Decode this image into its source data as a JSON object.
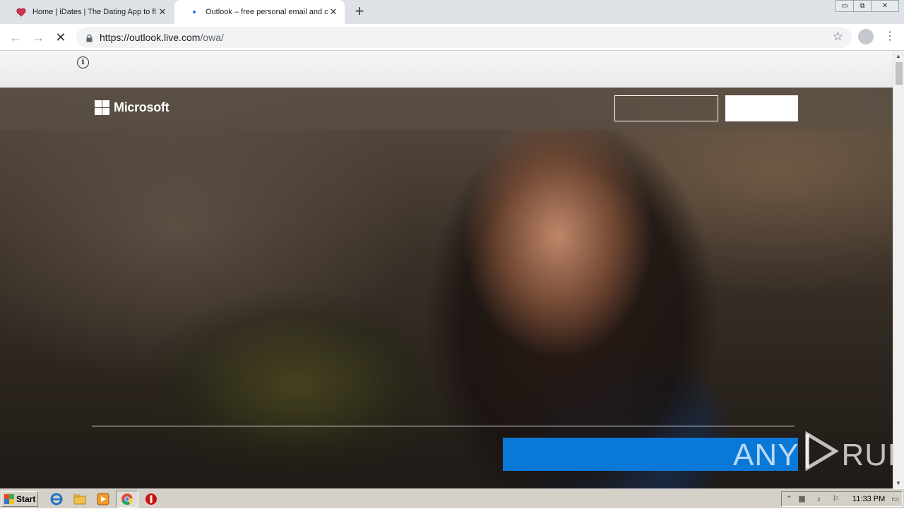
{
  "browser": {
    "tabs": [
      {
        "title": "Home | iDates | The Dating App to fl",
        "favicon": "heart-icon",
        "active": false
      },
      {
        "title": "Outlook – free personal email and ca",
        "favicon": "loading-dot-icon",
        "active": true
      }
    ],
    "new_tab_symbol": "+",
    "close_symbol": "✕",
    "url_host": "https://outlook.live.com",
    "url_path": "/owa/",
    "back_symbol": "←",
    "forward_symbol": "→",
    "reload_symbol": "✕",
    "star_symbol": "☆",
    "menu_symbol": "⋮",
    "window_controls": {
      "minimize": "▭",
      "restore": "⧉",
      "close": "✕"
    }
  },
  "page": {
    "info_symbol": "i",
    "brand": "Microsoft",
    "header_buttons": {
      "outline_label": "",
      "solid_label": ""
    },
    "cta_label": "",
    "watermark": {
      "left": "ANY",
      "right": "RUN"
    }
  },
  "taskbar": {
    "start_label": "Start",
    "clock": "11:33 PM",
    "colors": {
      "ie": "#1e73c8",
      "explorer": "#f0c24a",
      "media": "#f19a2a",
      "chrome_ring": "#dd4b39",
      "stop": "#cc1111"
    }
  }
}
